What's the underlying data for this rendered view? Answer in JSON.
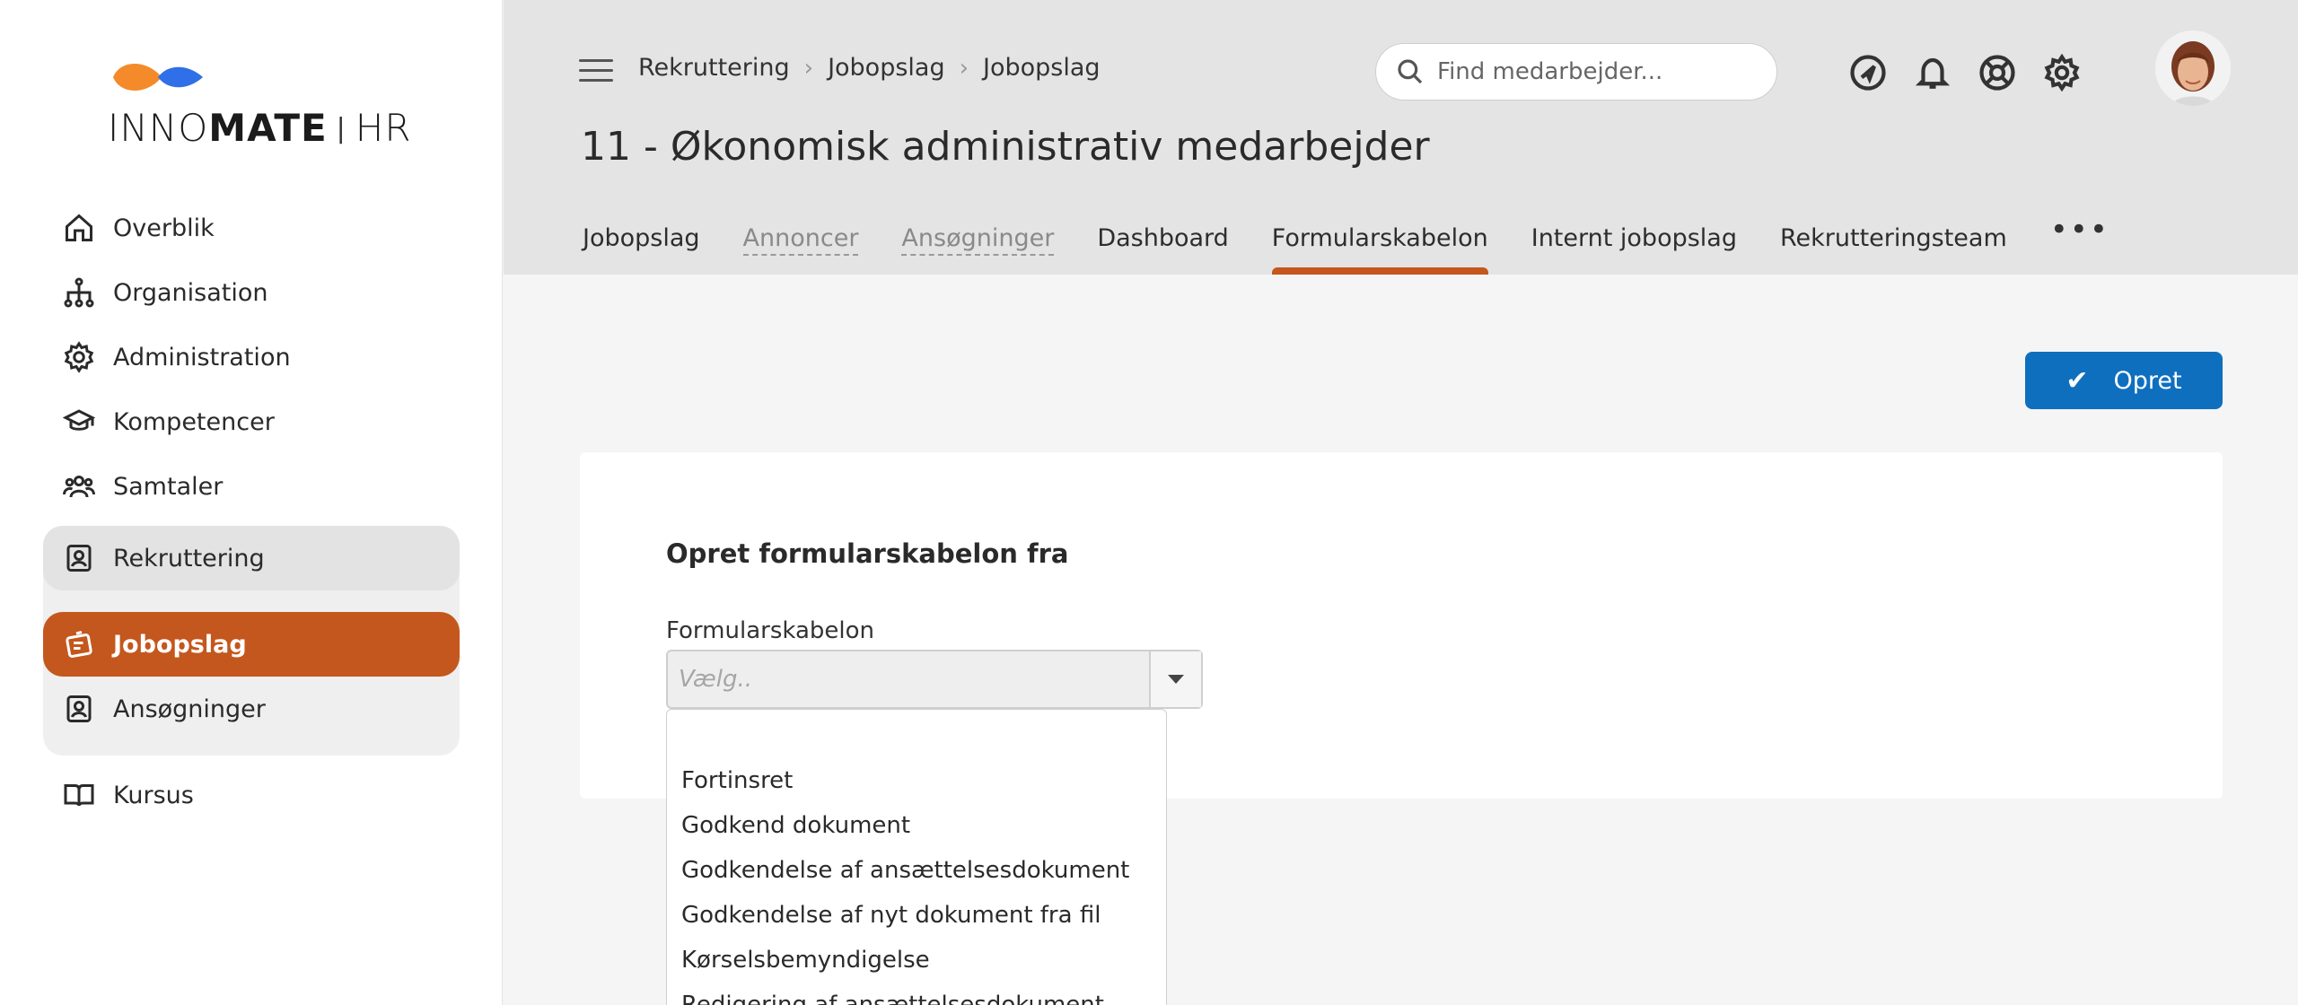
{
  "logo": {
    "part1": "INNO",
    "part2": "MATE",
    "part3": "HR"
  },
  "sidebar": {
    "items": [
      {
        "label": "Overblik",
        "icon": "home-icon"
      },
      {
        "label": "Organisation",
        "icon": "org-chart-icon"
      },
      {
        "label": "Administration",
        "icon": "gear-icon"
      },
      {
        "label": "Kompetencer",
        "icon": "graduation-cap-icon"
      },
      {
        "label": "Samtaler",
        "icon": "people-icon"
      }
    ],
    "group": {
      "parent": "Rekruttering",
      "active": "Jobopslag",
      "child": "Ansøgninger"
    },
    "last": "Kursus"
  },
  "header": {
    "breadcrumb": [
      "Rekruttering",
      "Jobopslag",
      "Jobopslag"
    ],
    "search_placeholder": "Find medarbejder...",
    "title": "11 - Økonomisk administrativ medarbejder",
    "tabs": [
      "Jobopslag",
      "Annoncer",
      "Ansøgninger",
      "Dashboard",
      "Formularskabelon",
      "Internt jobopslag",
      "Rekrutteringsteam"
    ],
    "more": "•••"
  },
  "actions": {
    "create_label": "Opret"
  },
  "form": {
    "heading": "Opret formularskabelon fra",
    "field_label": "Formularskabelon",
    "select_placeholder": "Vælg.."
  },
  "dropdown": {
    "options": [
      "Fortinsret",
      "Godkend dokument",
      "Godkendelse af ansættelsesdokument",
      "Godkendelse af nyt dokument fra fil",
      "Kørselsbemyndigelse",
      "Redigering af ansættelsesdokument"
    ]
  },
  "colors": {
    "accent": "#c4571d",
    "primary_button": "#0f6fbf",
    "logo_orange": "#f58a2a",
    "logo_blue": "#2f6fe8"
  }
}
